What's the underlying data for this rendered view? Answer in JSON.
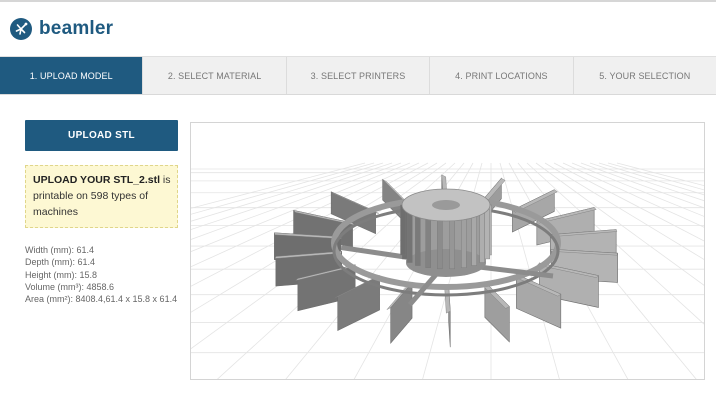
{
  "brand": {
    "name": "beamler",
    "logo_icon": "star-burst-icon",
    "color": "#1f5a80"
  },
  "steps": [
    {
      "label": "1. UPLOAD MODEL",
      "active": true
    },
    {
      "label": "2. SELECT MATERIAL",
      "active": false
    },
    {
      "label": "3. SELECT PRINTERS",
      "active": false
    },
    {
      "label": "4. PRINT LOCATIONS",
      "active": false
    },
    {
      "label": "5. YOUR SELECTION",
      "active": false
    }
  ],
  "upload": {
    "button_label": "UPLOAD STL"
  },
  "notice": {
    "bold": "UPLOAD YOUR STL_2.stl",
    "text": " is printable on 598 types of machines"
  },
  "dimensions": {
    "width": "Width (mm): 61.4",
    "depth": "Depth (mm): 61.4",
    "height": "Height (mm): 15.8",
    "volume": "Volume (mm³): 4858.6",
    "area": "Area (mm²): 8408.4,61.4 x 15.8 x 61.4"
  },
  "viewer": {
    "model": "gear-wheel-3d-model",
    "grid_color": "#e4e4e4",
    "model_color": "#8e8e8e"
  }
}
